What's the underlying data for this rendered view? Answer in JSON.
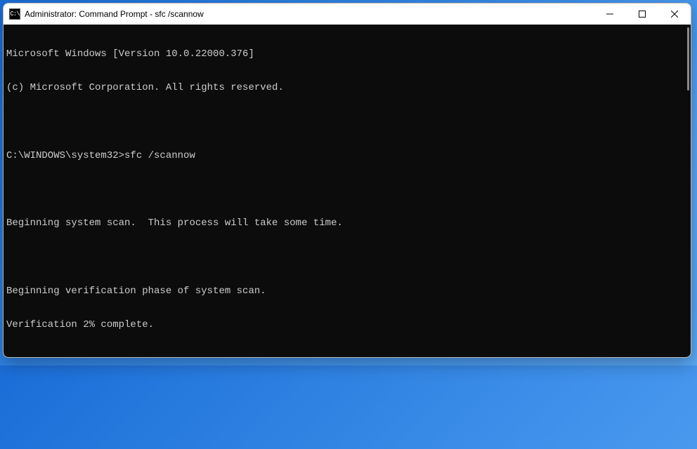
{
  "window": {
    "title": "Administrator: Command Prompt - sfc  /scannow",
    "icon_label": "C:\\"
  },
  "terminal": {
    "lines": [
      "Microsoft Windows [Version 10.0.22000.376]",
      "(c) Microsoft Corporation. All rights reserved.",
      "",
      "C:\\WINDOWS\\system32>sfc /scannow",
      "",
      "Beginning system scan.  This process will take some time.",
      "",
      "Beginning verification phase of system scan.",
      "Verification 2% complete."
    ]
  }
}
